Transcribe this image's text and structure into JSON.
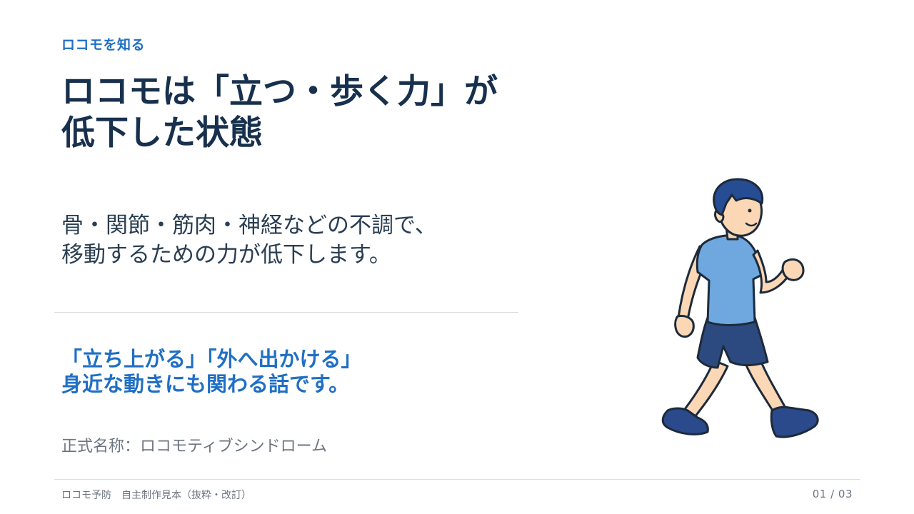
{
  "eyebrow": "ロコモを知る",
  "title": {
    "line1": "ロコモは「立つ・歩く力」が",
    "line2": "低下した状態"
  },
  "lead": {
    "line1": "骨・関節・筋肉・神経などの不調で、",
    "line2": "移動するための力が低下します。"
  },
  "highlight": {
    "line1": "「立ち上がる」「外へ出かける」",
    "line2": "身近な動きにも関わる話です。"
  },
  "formal_name": "正式名称：ロコモティブシンドローム",
  "footer": {
    "source": "ロコモ予防　自主制作見本（抜粋・改訂）",
    "page": "01 / 03"
  },
  "illustration": {
    "name": "walking-man-illustration",
    "colors": {
      "shirt": "#6ea8df",
      "shorts": "#2d4a80",
      "shoes": "#2a4a8c",
      "hair": "#264d93",
      "skin": "#fcd7b5",
      "outline": "#1d2a3a"
    }
  },
  "colors": {
    "accent": "#1f6fc4",
    "title": "#17304d",
    "body": "#2a3e52",
    "muted": "#6d7680"
  }
}
